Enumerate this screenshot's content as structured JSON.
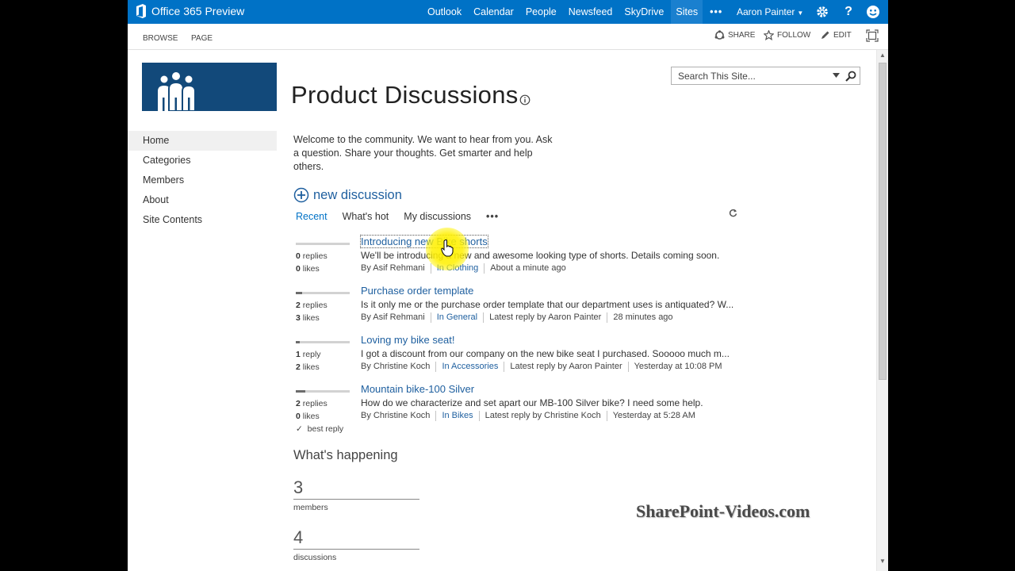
{
  "suitebar": {
    "brand": "Office 365 Preview",
    "nav": [
      "Outlook",
      "Calendar",
      "People",
      "Newsfeed",
      "SkyDrive",
      "Sites"
    ],
    "more": "•••",
    "user": "Aaron Painter",
    "help": "?"
  },
  "ribbon": {
    "tabs": [
      "BROWSE",
      "PAGE"
    ],
    "share": "SHARE",
    "follow": "FOLLOW",
    "edit": "EDIT"
  },
  "leftnav": [
    "Home",
    "Categories",
    "Members",
    "About",
    "Site Contents"
  ],
  "search": {
    "placeholder": "Search This Site..."
  },
  "page": {
    "title": "Product Discussions",
    "welcome": "Welcome to the community. We want to hear from you. Ask a question. Share your thoughts. Get smarter and help others.",
    "new_discussion": "new discussion",
    "filters": [
      "Recent",
      "What's hot",
      "My discussions",
      "•••"
    ]
  },
  "discussions": [
    {
      "replies_count": "0",
      "replies_label": "replies",
      "likes_count": "0",
      "likes_label": "likes",
      "title": "Introducing new Bike shorts",
      "excerpt": "We'll be introducing a new and awesome looking type of shorts. Details coming soon.",
      "author": "By Asif Rehmani",
      "category": "In Clothing",
      "latest": "",
      "time": "About a minute ago",
      "activity": 0.0
    },
    {
      "replies_count": "2",
      "replies_label": "replies",
      "likes_count": "3",
      "likes_label": "likes",
      "title": "Purchase order template",
      "excerpt": "Is it only me or the purchase order template that our department uses is antiquated? W...",
      "author": "By Asif Rehmani",
      "category": "In General",
      "latest": "Latest reply by Aaron Painter",
      "time": "28 minutes ago",
      "activity": 0.12
    },
    {
      "replies_count": "1",
      "replies_label": "reply",
      "likes_count": "2",
      "likes_label": "likes",
      "title": "Loving my bike seat!",
      "excerpt": "I got a discount from our company on the new bike seat I purchased. Sooooo much m...",
      "author": "By Christine Koch",
      "category": "In Accessories",
      "latest": "Latest reply by Aaron Painter",
      "time": "Yesterday at 10:08 PM",
      "activity": 0.08
    },
    {
      "replies_count": "2",
      "replies_label": "replies",
      "likes_count": "0",
      "likes_label": "likes",
      "best_reply": "best reply",
      "title": "Mountain bike-100 Silver",
      "excerpt": "How do we characterize and set apart our MB-100 Silver bike? I need some help.",
      "author": "By Christine Koch",
      "category": "In Bikes",
      "latest": "Latest reply by Christine Koch",
      "time": "Yesterday at 5:28 AM",
      "activity": 0.18
    }
  ],
  "happening": {
    "title": "What's happening",
    "metrics": [
      {
        "value": "3",
        "label": "members"
      },
      {
        "value": "4",
        "label": "discussions"
      }
    ]
  },
  "watermark": "SharePoint-Videos.com",
  "colors": {
    "suitebar": "#0072c6",
    "logo_tile": "#12497a",
    "link": "#1e5f9f"
  }
}
